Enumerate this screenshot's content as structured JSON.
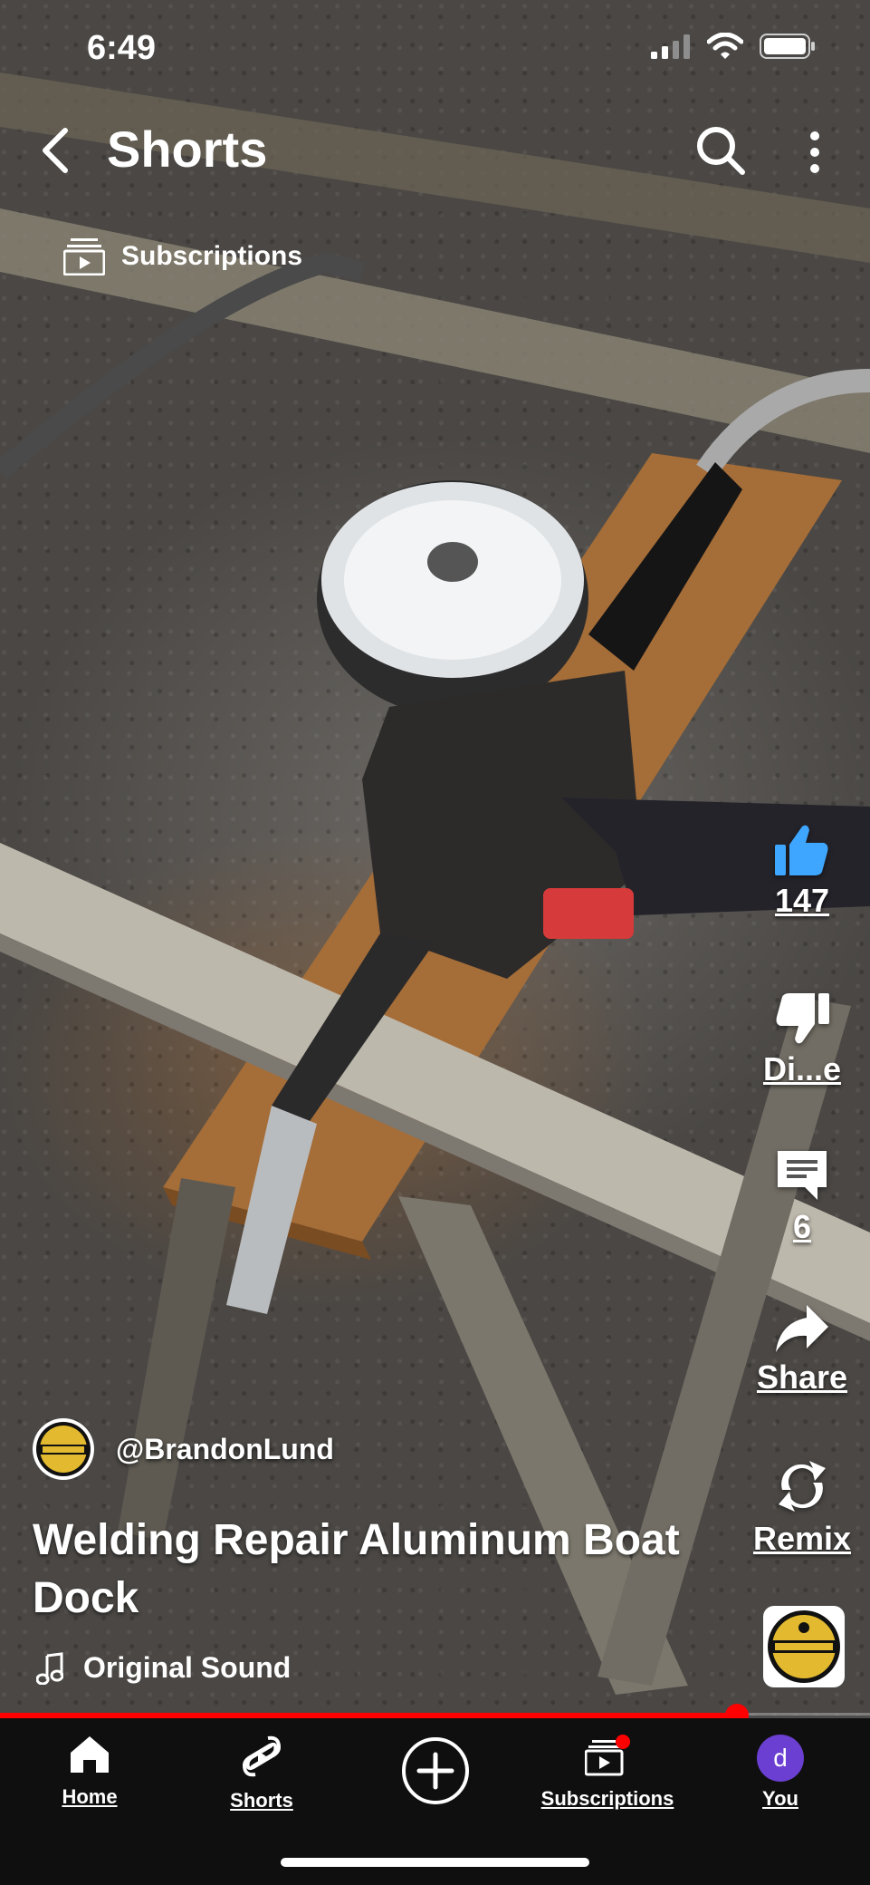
{
  "status_bar": {
    "time": "6:49"
  },
  "header": {
    "title": "Shorts"
  },
  "subscriptions_pill": {
    "label": "Subscriptions"
  },
  "actions": {
    "like": {
      "label": "147"
    },
    "dislike": {
      "label": "Di...e"
    },
    "comments": {
      "label": "6"
    },
    "share": {
      "label": "Share"
    },
    "remix": {
      "label": "Remix"
    }
  },
  "channel": {
    "handle": "@BrandonLund",
    "logo_text": "LUND DIY BUILDS"
  },
  "video": {
    "title": "Welding Repair Aluminum Boat Dock",
    "sound": "Original Sound",
    "progress": 0.847
  },
  "bottom_nav": [
    {
      "label": "Home",
      "icon": "home-icon"
    },
    {
      "label": "Shorts",
      "icon": "shorts-icon"
    },
    {
      "label": "",
      "icon": "create-icon"
    },
    {
      "label": "Subscriptions",
      "icon": "subscriptions-icon"
    },
    {
      "label": "You",
      "icon": "avatar",
      "avatar_letter": "d"
    }
  ],
  "colors": {
    "accent": "#ff0000",
    "like": "#3ea6ff",
    "avatar": "#6b3fd1",
    "nav_bg": "#0f0f0f"
  }
}
